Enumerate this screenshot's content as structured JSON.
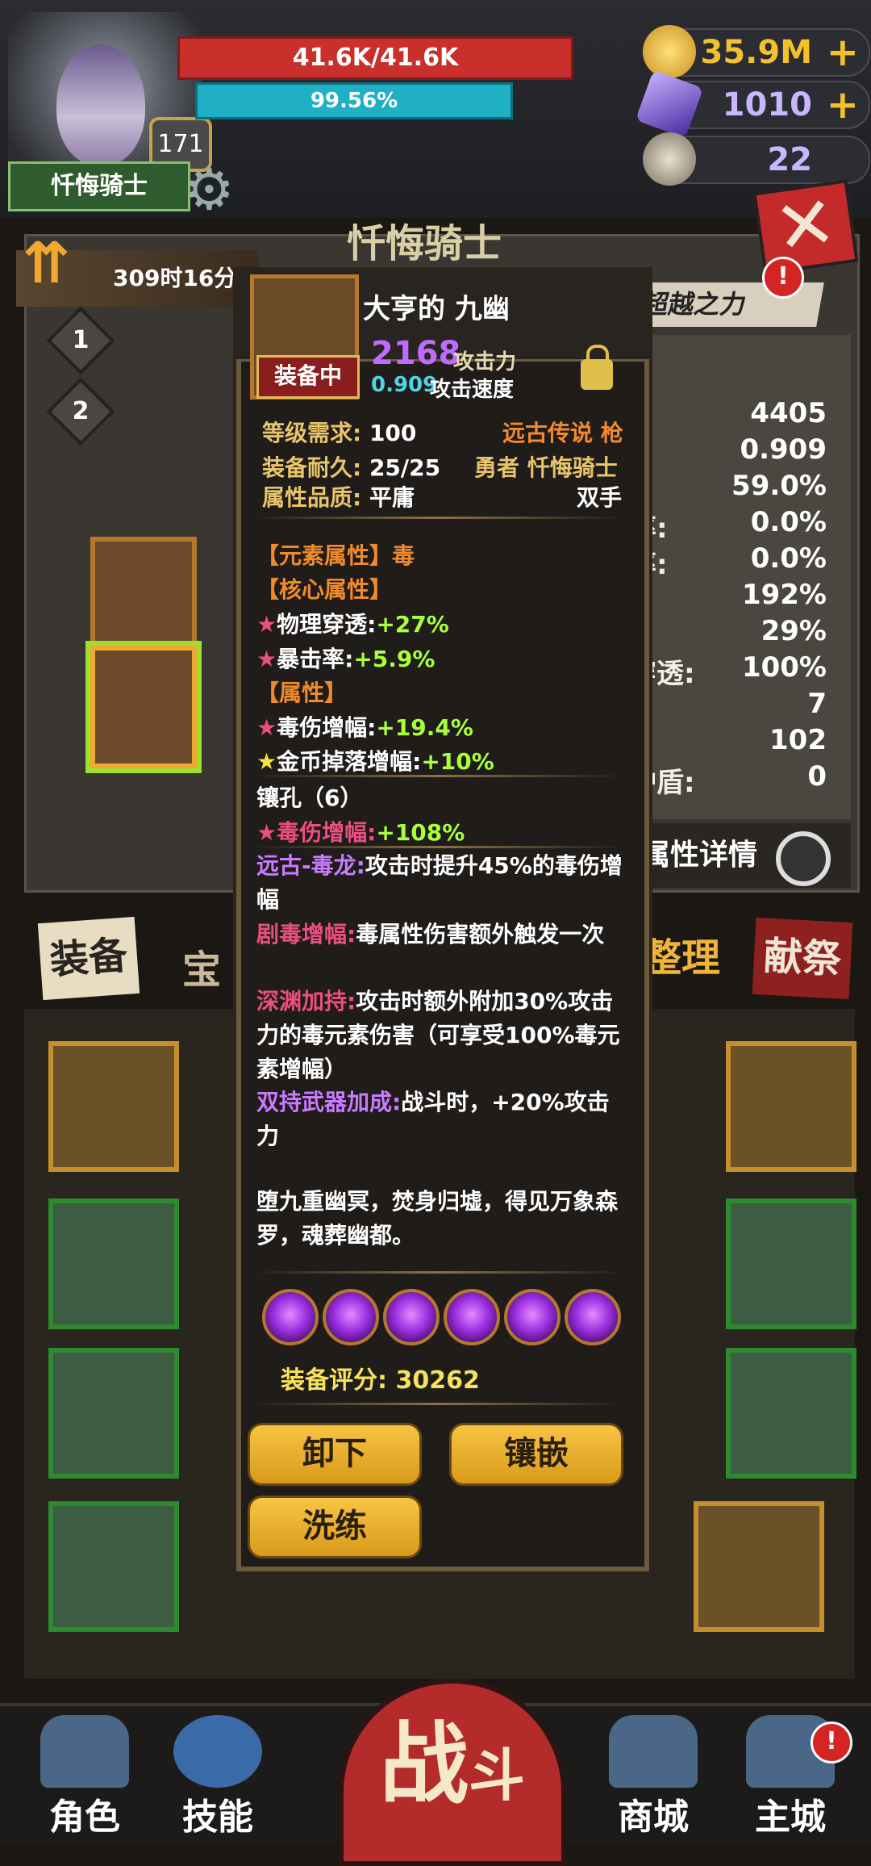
{
  "player": {
    "hp": "41.6K/41.6K",
    "hp_percent": 100,
    "exp": "99.56%",
    "exp_percent": 99.56,
    "level": "171",
    "name": "忏悔骑士"
  },
  "resources": {
    "gold": "35.9M",
    "crystal": "1010",
    "ram_horn": "22",
    "plus": "+"
  },
  "panel": {
    "title": "忏悔骑士",
    "timer": "309时16分",
    "stage_1": "1",
    "stage_2": "2",
    "surpass": "超越之力",
    "detail_button": "属性详情"
  },
  "side_stats": [
    {
      "label": "",
      "value": "4405"
    },
    {
      "label": ":",
      "value": "0.909"
    },
    {
      "label": "",
      "value": "59.0%"
    },
    {
      "label": "率:",
      "value": "0.0%"
    },
    {
      "label": "率:",
      "value": "0.0%"
    },
    {
      "label": ":",
      "value": "192%"
    },
    {
      "label": ":",
      "value": "29%"
    },
    {
      "label": "穿透:",
      "value": "100%"
    },
    {
      "label": ":",
      "value": "7"
    },
    {
      "label": ":",
      "value": "102"
    },
    {
      "label": "护盾:",
      "value": "0"
    }
  ],
  "tabs": {
    "equip": "装备",
    "treasure": "宝石",
    "sort": "整理",
    "sacrifice": "献祭"
  },
  "item": {
    "name": "大亨的 九幽",
    "equipped_tag": "装备中",
    "attack": "2168",
    "attack_label": "攻击力",
    "speed": "0.909",
    "speed_label": "攻击速度",
    "level_req_label": "等级需求:",
    "level_req": "100",
    "rarity": "远古传说 枪",
    "durability_label": "装备耐久:",
    "durability": "25/25",
    "owner": "勇者 忏悔骑士",
    "quality_label": "属性品质:",
    "quality": "平庸",
    "hand": "双手",
    "element_header": "【元素属性】毒",
    "core_header": "【核心属性】",
    "core_1_label": "物理穿透:",
    "core_1_value": "+27%",
    "core_2_label": "暴击率:",
    "core_2_value": "+5.9%",
    "attr_header": "【属性】",
    "attr_1_label": "毒伤增幅:",
    "attr_1_value": "+19.4%",
    "attr_2_label": "金币掉落增幅:",
    "attr_2_value": "+10%",
    "socket_header": "镶孔（6）",
    "socket_1_label": "毒伤增幅:",
    "socket_1_value": "+108%",
    "skill_1_name": "远古-毒龙:",
    "skill_1_text": "攻击时提升45%的毒伤增幅",
    "skill_2_name": "剧毒增幅:",
    "skill_2_text": "毒属性伤害额外触发一次",
    "skill_3_name": "深渊加持:",
    "skill_3_text": "攻击时额外附加30%攻击力的毒元素伤害（可享受100%毒元素增幅）",
    "skill_4_name": "双持武器加成:",
    "skill_4_text": "战斗时，+20%攻击力",
    "lore": "堕九重幽冥，焚身归墟，得见万象森罗，魂葬幽都。",
    "score_label": "装备评分:",
    "score": "30262",
    "btn_unequip": "卸下",
    "btn_inlay": "镶嵌",
    "btn_refine": "洗练"
  },
  "bottom_nav": {
    "role": "角色",
    "skill": "技能",
    "fight_1": "战",
    "fight_2": "斗",
    "shop": "商城",
    "city": "主城",
    "badge": "!"
  },
  "colors": {
    "hp": "#c9302c",
    "exp": "#1fb0c6",
    "gold_text": "#f2c12c",
    "crystal_text": "#c9b6ff"
  }
}
